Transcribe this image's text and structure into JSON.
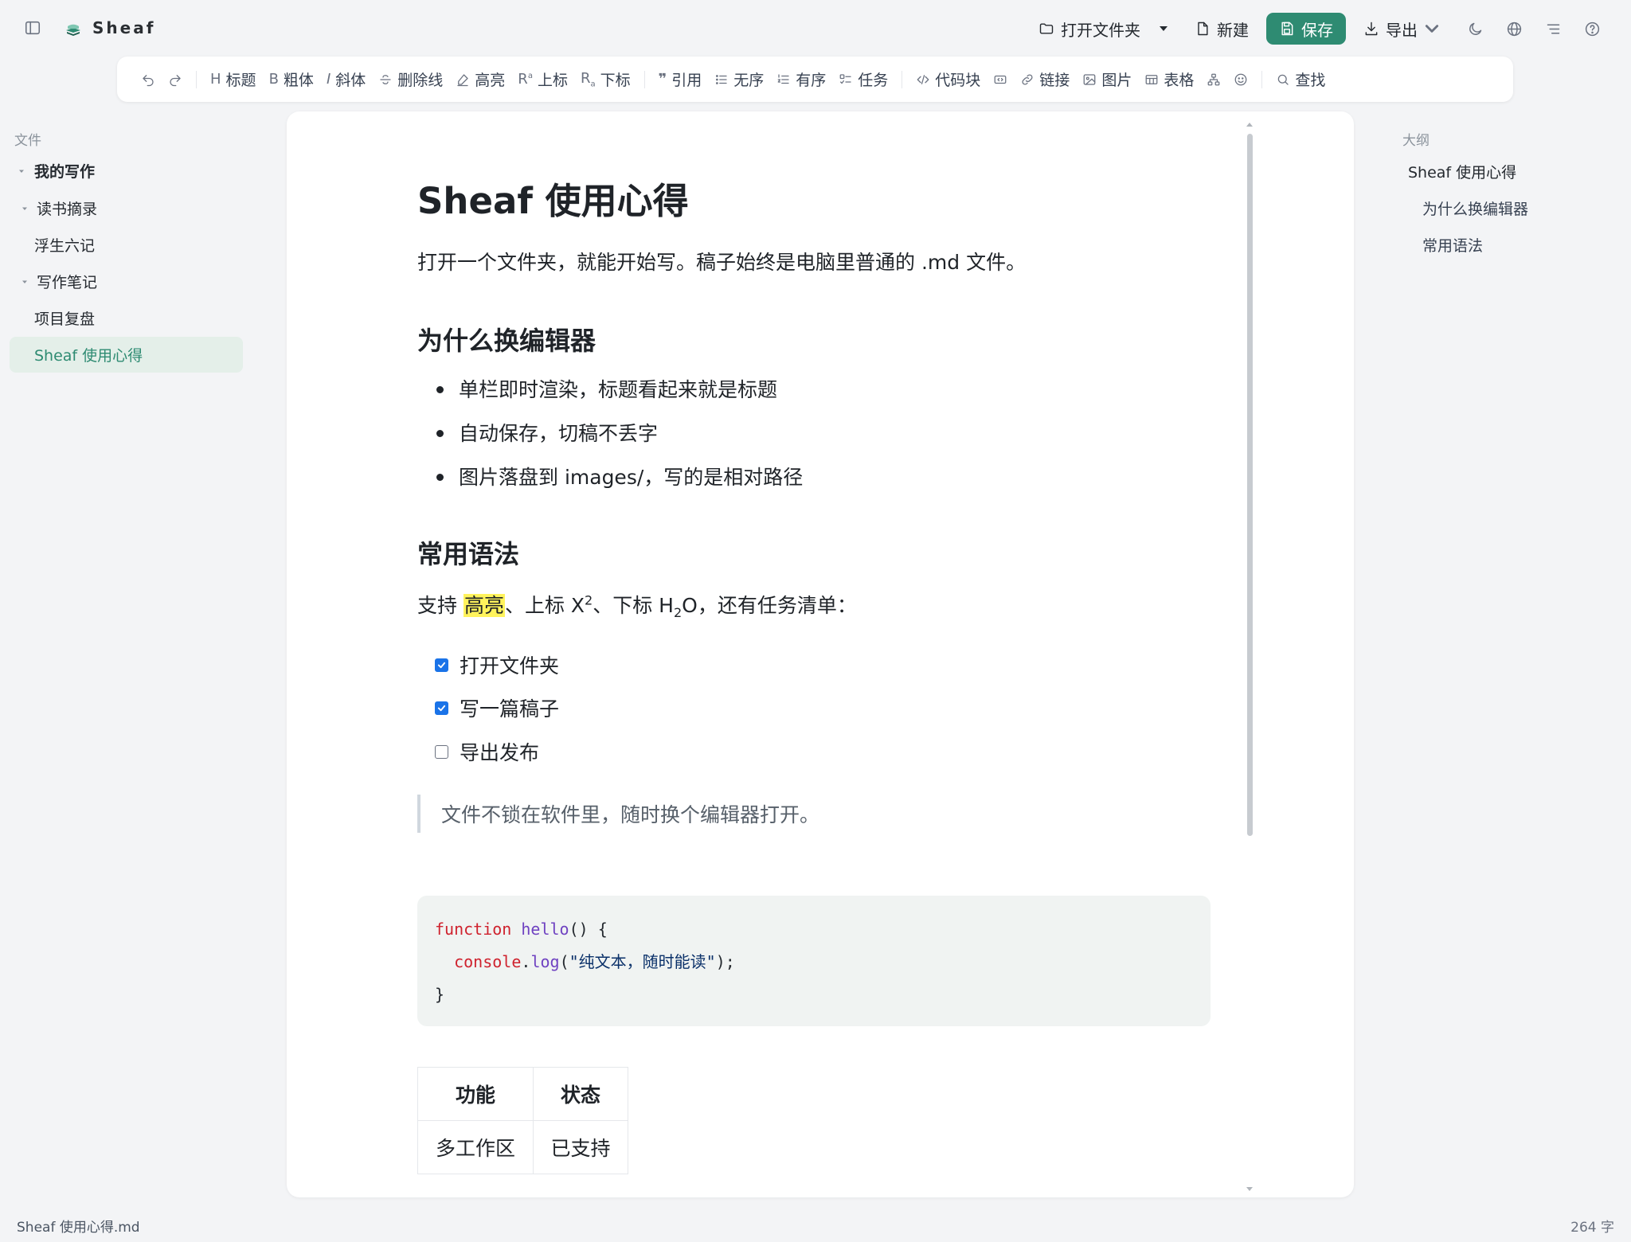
{
  "app": {
    "title": "Sheaf"
  },
  "topbar": {
    "open_folder": "打开文件夹",
    "new": "新建",
    "save": "保存",
    "export": "导出"
  },
  "toolbar": {
    "heading": "标题",
    "bold": "粗体",
    "italic": "斜体",
    "strike": "删除线",
    "highlight": "高亮",
    "superscript": "上标",
    "subscript": "下标",
    "quote": "引用",
    "unordered": "无序",
    "ordered": "有序",
    "task": "任务",
    "code_block": "代码块",
    "link": "链接",
    "image": "图片",
    "table": "表格",
    "find": "查找"
  },
  "sidebar": {
    "heading": "文件",
    "items": [
      {
        "label": "我的写作"
      },
      {
        "label": "读书摘录"
      },
      {
        "label": "浮生六记"
      },
      {
        "label": "写作笔记"
      },
      {
        "label": "项目复盘"
      },
      {
        "label": "Sheaf 使用心得"
      }
    ]
  },
  "doc": {
    "title": "Sheaf 使用心得",
    "intro": "打开一个文件夹，就能开始写。稿子始终是电脑里普通的 .md 文件。",
    "h2_why": "为什么换编辑器",
    "bullets": [
      "单栏即时渲染，标题看起来就是标题",
      "自动保存，切稿不丢字",
      "图片落盘到 images/，写的是相对路径"
    ],
    "h2_syntax": "常用语法",
    "syntax_line": {
      "a": "支持 ",
      "mark": "高亮",
      "b": "、上标 X",
      "sup": "2",
      "c": "、下标 H",
      "sub": "2",
      "d": "O，还有任务清单："
    },
    "tasks": [
      {
        "label": "打开文件夹",
        "checked": true
      },
      {
        "label": "写一篇稿子",
        "checked": true
      },
      {
        "label": "导出发布",
        "checked": false
      }
    ],
    "quote": "文件不锁在软件里，随时换个编辑器打开。",
    "code": {
      "l1_kw": "function",
      "l1_fn": "hello",
      "l1_rest": "() {",
      "l2_obj": "console",
      "l2_dot": ".",
      "l2_fn": "log",
      "l2_open": "(",
      "l2_str": "\"纯文本，随时能读\"",
      "l2_close": ");",
      "l3": "}"
    },
    "table": {
      "headers": [
        "功能",
        "状态"
      ],
      "rows": [
        [
          "多工作区",
          "已支持"
        ]
      ]
    }
  },
  "outline": {
    "heading": "大纲",
    "items": [
      "Sheaf 使用心得",
      "为什么换编辑器",
      "常用语法"
    ]
  },
  "status": {
    "filename": "Sheaf 使用心得.md",
    "word_count": "264 字"
  },
  "colors": {
    "accent": "#2e8b72",
    "active_bg": "#e4efe9",
    "highlight": "#fff35c",
    "checkbox": "#1a73e8"
  }
}
